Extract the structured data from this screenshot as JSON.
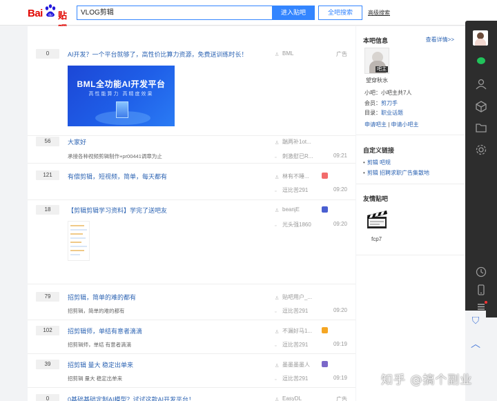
{
  "header": {
    "logo_text_bai": "Bai",
    "logo_text_tieba": "贴吧",
    "search_value": "VLOG剪辑",
    "enter_button": "进入贴吧",
    "search_all_button": "全吧搜索",
    "advanced_search": "高级搜索"
  },
  "threads": [
    {
      "replies": "0",
      "title": "AI开发？一个平台就够了，高性价比算力资源，免费送训练时长！",
      "author": "BML",
      "meta": "广告",
      "ad": {
        "title": "BML全功能AI开发平台",
        "subtitle": "高性能算力  高精度效果"
      }
    },
    {
      "replies": "56",
      "title": "大家好",
      "desc": "承接各种视频剪辑制作+pr00441调章为止",
      "author": "踹两补1ot...",
      "last_reply": "刺激慰已R...",
      "time": "09:21"
    },
    {
      "replies": "121",
      "title": "有偿剪辑，短视频，简单，每天都有",
      "author": "林有不睡...",
      "last_reply": "逗比苦291",
      "time": "09:20"
    },
    {
      "replies": "18",
      "title": "【剪辑剪辑学习资料】学完了送吧友",
      "author": "beanjE",
      "last_reply": "光头强1860",
      "time": "09:20"
    },
    {
      "replies": "79",
      "title": "招剪辑，简单的难的都有",
      "desc": "招剪辑，简单的难的都有",
      "author": "贴吧用户_...",
      "last_reply": "逗比苦291",
      "time": "09:20"
    },
    {
      "replies": "102",
      "title": "招剪辑师，单结有意者滴滴",
      "desc": "招剪辑师，单结 有意者滴滴",
      "author": "不漏好马1...",
      "last_reply": "逗比苦291",
      "time": "09:19"
    },
    {
      "replies": "39",
      "title": "招剪辑 量大 稳定出单来",
      "desc": "招剪辑 量大 稳定出单来",
      "author": "墨墨墨墨人",
      "last_reply": "逗比苦291",
      "time": "09:19"
    },
    {
      "replies": "0",
      "title": "0基础基础定制AI模型？试试这款AI开发平台！",
      "author": "EasyDL",
      "meta": "广告"
    }
  ],
  "sidebar": {
    "info_title": "本吧信息",
    "info_more": "查看详情>>",
    "owner_tag": "吧主",
    "owner_name": "望穿秋水",
    "small_owner": "小吧：小吧主共7人",
    "members_label": "会员：",
    "members_value": "剪刀手",
    "catalog_label": "目录：",
    "catalog_value": "职业话题",
    "apply_owner": "申请吧主",
    "link_sep": " | ",
    "apply_small_owner": "申请小吧主",
    "custom_links_title": "自定义链接",
    "custom_links": [
      "剪辑 吧规",
      "剪辑 招聘求职广告集散地"
    ],
    "friend_title": "友情贴吧",
    "friend_name": "fcp7"
  },
  "toolbar": {
    "icons": [
      "avatar-icon",
      "chat-icon",
      "user-icon",
      "cube-icon",
      "folder-icon",
      "settings-icon",
      "clock-icon",
      "phone-icon",
      "menu-icon"
    ]
  },
  "watermark": "知乎 @搞个副业",
  "colors": {
    "brand_red": "#e10601",
    "link_blue": "#2d64b3",
    "button_blue": "#3385ff"
  }
}
